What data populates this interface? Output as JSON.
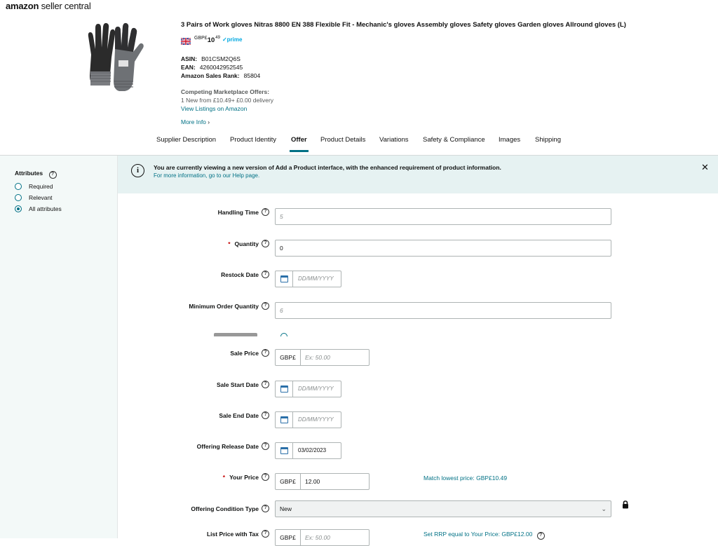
{
  "brand": {
    "logo_bold": "amazon",
    "logo_rest": " seller central"
  },
  "product": {
    "title": "3 Pairs of Work gloves Nitras 8800 EN 388 Flexible Fit - Mechanic's gloves Assembly gloves Safety gloves Garden gloves Allround gloves (L)",
    "currency": "GBP£",
    "price_main": "10",
    "price_frac": "49",
    "prime": "✓prime",
    "asin_label": "ASIN:",
    "asin": "B01CSM2Q6S",
    "ean_label": "EAN:",
    "ean": "4260042952545",
    "rank_label": "Amazon Sales Rank:",
    "rank": "85804",
    "competing_label": "Competing Marketplace Offers:",
    "competing_offer": "1 New  from £10.49+ £0.00 delivery",
    "view_listings": "View Listings on Amazon",
    "more_info": "More Info"
  },
  "tabs": [
    {
      "label": "Supplier Description",
      "active": false
    },
    {
      "label": "Product Identity",
      "active": false
    },
    {
      "label": "Offer",
      "active": true
    },
    {
      "label": "Product Details",
      "active": false
    },
    {
      "label": "Variations",
      "active": false
    },
    {
      "label": "Safety & Compliance",
      "active": false
    },
    {
      "label": "Images",
      "active": false
    },
    {
      "label": "Shipping",
      "active": false
    }
  ],
  "sidebar": {
    "title": "Attributes",
    "options": [
      {
        "label": "Required",
        "selected": false
      },
      {
        "label": "Relevant",
        "selected": false
      },
      {
        "label": "All attributes",
        "selected": true
      }
    ]
  },
  "banner": {
    "message": "You are currently viewing a new version of Add a Product interface, with the enhanced requirement of product information.",
    "sub_text": "For more information, go to our Help page."
  },
  "form": {
    "handling_time": {
      "label": "Handling Time",
      "placeholder": "5"
    },
    "quantity": {
      "label": "Quantity",
      "value": "0",
      "required": "*"
    },
    "restock_date": {
      "label": "Restock Date",
      "placeholder": "DD/MM/YYYY"
    },
    "min_order_qty": {
      "label": "Minimum Order Quantity",
      "placeholder": "6"
    },
    "sale_price": {
      "label": "Sale Price",
      "currency": "GBP£",
      "placeholder": "Ex: 50.00"
    },
    "sale_start": {
      "label": "Sale Start Date",
      "placeholder": "DD/MM/YYYY"
    },
    "sale_end": {
      "label": "Sale End Date",
      "placeholder": "DD/MM/YYYY"
    },
    "release_date": {
      "label": "Offering Release Date",
      "value": "03/02/2023"
    },
    "your_price": {
      "label": "Your Price",
      "currency": "GBP£",
      "value": "12.00",
      "required": "*",
      "match_link": "Match lowest price: GBP£10.49"
    },
    "condition": {
      "label": "Offering Condition Type",
      "value": "New"
    },
    "list_price": {
      "label": "List Price with Tax",
      "currency": "GBP£",
      "placeholder": "Ex: 50.00",
      "rrp_link": "Set RRP equal to Your Price: GBP£12.00"
    }
  }
}
